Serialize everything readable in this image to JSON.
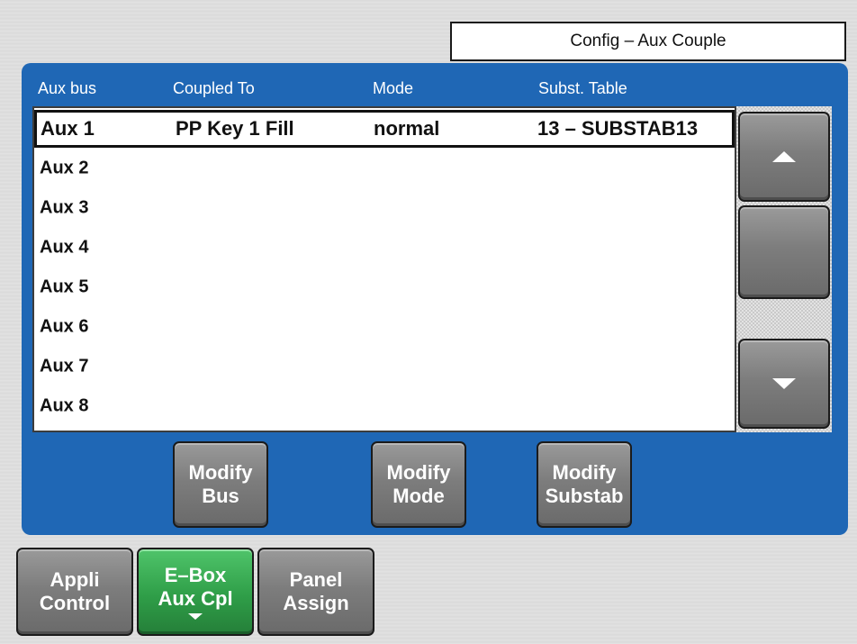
{
  "window": {
    "title": "Config – Aux Couple"
  },
  "table": {
    "headers": {
      "aux_bus": "Aux bus",
      "coupled_to": "Coupled To",
      "mode": "Mode",
      "subst_table": "Subst. Table"
    },
    "rows": [
      {
        "aux_bus": "Aux 1",
        "coupled_to": "PP Key 1 Fill",
        "mode": "normal",
        "subst_table": "13 – SUBSTAB13",
        "selected": true
      },
      {
        "aux_bus": "Aux 2",
        "coupled_to": "",
        "mode": "",
        "subst_table": ""
      },
      {
        "aux_bus": "Aux 3",
        "coupled_to": "",
        "mode": "",
        "subst_table": ""
      },
      {
        "aux_bus": "Aux 4",
        "coupled_to": "",
        "mode": "",
        "subst_table": ""
      },
      {
        "aux_bus": "Aux 5",
        "coupled_to": "",
        "mode": "",
        "subst_table": ""
      },
      {
        "aux_bus": "Aux 6",
        "coupled_to": "",
        "mode": "",
        "subst_table": ""
      },
      {
        "aux_bus": "Aux 7",
        "coupled_to": "",
        "mode": "",
        "subst_table": ""
      },
      {
        "aux_bus": "Aux 8",
        "coupled_to": "",
        "mode": "",
        "subst_table": ""
      }
    ]
  },
  "scroll": {
    "up_icon": "triangle-up-icon",
    "down_icon": "triangle-down-icon"
  },
  "actions": {
    "modify_bus": [
      "Modify",
      "Bus"
    ],
    "modify_mode": [
      "Modify",
      "Mode"
    ],
    "modify_substab": [
      "Modify",
      "Substab"
    ]
  },
  "nav": {
    "appli_control": [
      "Appli",
      "Control"
    ],
    "ebox_aux_cpl": [
      "E–Box",
      "Aux Cpl"
    ],
    "panel_assign": [
      "Panel",
      "Assign"
    ]
  },
  "colors": {
    "panel_blue": "#1f67b5",
    "active_green": "#2f9e48",
    "button_grey": "#7d7d7d"
  }
}
